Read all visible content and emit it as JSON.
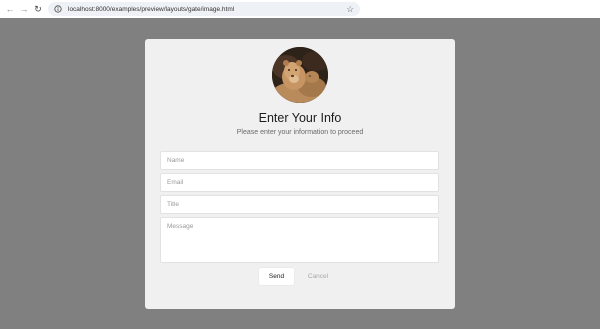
{
  "browser": {
    "back_icon": "arrow-left-icon",
    "forward_icon": "arrow-right-icon",
    "reload_icon": "reload-icon",
    "site_info_icon": "site-info-icon",
    "url": "localhost:8000/examples/preview/layouts/gate/image.html",
    "bookmark_icon": "star-icon"
  },
  "form": {
    "avatar_icon": "lion-avatar-image",
    "title": "Enter Your Info",
    "subtitle": "Please enter your information to proceed",
    "fields": {
      "name_placeholder": "Name",
      "email_placeholder": "Email",
      "title_placeholder": "Title",
      "message_placeholder": "Message"
    },
    "send_label": "Send",
    "cancel_label": "Cancel"
  },
  "colors": {
    "page_background": "#808080",
    "card_background": "#f0f0f0",
    "url_bar_background": "#eef1f6"
  }
}
